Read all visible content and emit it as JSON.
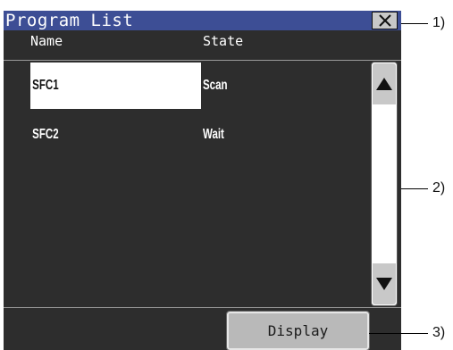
{
  "window": {
    "title": "Program List",
    "close_icon": "close-icon"
  },
  "columns": {
    "name": "Name",
    "state": "State"
  },
  "programs": [
    {
      "name": "SFC1",
      "state": "Scan",
      "selected": true
    },
    {
      "name": "SFC2",
      "state": "Wait",
      "selected": false
    }
  ],
  "scrollbar": {
    "up_icon": "triangle-up-icon",
    "down_icon": "triangle-down-icon"
  },
  "footer": {
    "display_label": "Display"
  },
  "callouts": [
    "1)",
    "2)",
    "3)"
  ],
  "colors": {
    "titlebar": "#3d4e95",
    "window_bg": "#2d2d2d",
    "selection": "#ffffff",
    "button_bg": "#b9b9b9"
  }
}
